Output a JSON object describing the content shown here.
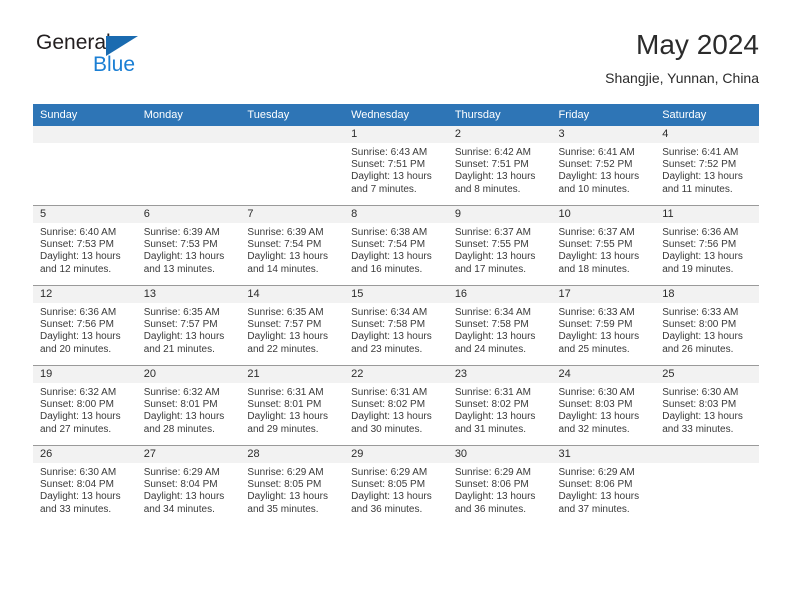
{
  "brand": {
    "name_top": "General",
    "name_bottom": "Blue",
    "triangle_color": "#1a6bb0",
    "blue_color": "#1b7fd4"
  },
  "header": {
    "title": "May 2024",
    "subtitle": "Shangjie, Yunnan, China"
  },
  "theme": {
    "header_bg": "#2e75b6",
    "header_text": "#ffffff",
    "daynum_bg": "#f2f2f2",
    "row_border": "#9a9a9a",
    "body_text": "#3a3a3a"
  },
  "weekdays": [
    "Sunday",
    "Monday",
    "Tuesday",
    "Wednesday",
    "Thursday",
    "Friday",
    "Saturday"
  ],
  "weeks": [
    [
      {
        "day": "",
        "empty": true,
        "sunrise": "",
        "sunset": "",
        "daylight_a": "",
        "daylight_b": ""
      },
      {
        "day": "",
        "empty": true,
        "sunrise": "",
        "sunset": "",
        "daylight_a": "",
        "daylight_b": ""
      },
      {
        "day": "",
        "empty": true,
        "sunrise": "",
        "sunset": "",
        "daylight_a": "",
        "daylight_b": ""
      },
      {
        "day": "1",
        "empty": false,
        "sunrise": "Sunrise: 6:43 AM",
        "sunset": "Sunset: 7:51 PM",
        "daylight_a": "Daylight: 13 hours",
        "daylight_b": "and 7 minutes."
      },
      {
        "day": "2",
        "empty": false,
        "sunrise": "Sunrise: 6:42 AM",
        "sunset": "Sunset: 7:51 PM",
        "daylight_a": "Daylight: 13 hours",
        "daylight_b": "and 8 minutes."
      },
      {
        "day": "3",
        "empty": false,
        "sunrise": "Sunrise: 6:41 AM",
        "sunset": "Sunset: 7:52 PM",
        "daylight_a": "Daylight: 13 hours",
        "daylight_b": "and 10 minutes."
      },
      {
        "day": "4",
        "empty": false,
        "sunrise": "Sunrise: 6:41 AM",
        "sunset": "Sunset: 7:52 PM",
        "daylight_a": "Daylight: 13 hours",
        "daylight_b": "and 11 minutes."
      }
    ],
    [
      {
        "day": "5",
        "empty": false,
        "sunrise": "Sunrise: 6:40 AM",
        "sunset": "Sunset: 7:53 PM",
        "daylight_a": "Daylight: 13 hours",
        "daylight_b": "and 12 minutes."
      },
      {
        "day": "6",
        "empty": false,
        "sunrise": "Sunrise: 6:39 AM",
        "sunset": "Sunset: 7:53 PM",
        "daylight_a": "Daylight: 13 hours",
        "daylight_b": "and 13 minutes."
      },
      {
        "day": "7",
        "empty": false,
        "sunrise": "Sunrise: 6:39 AM",
        "sunset": "Sunset: 7:54 PM",
        "daylight_a": "Daylight: 13 hours",
        "daylight_b": "and 14 minutes."
      },
      {
        "day": "8",
        "empty": false,
        "sunrise": "Sunrise: 6:38 AM",
        "sunset": "Sunset: 7:54 PM",
        "daylight_a": "Daylight: 13 hours",
        "daylight_b": "and 16 minutes."
      },
      {
        "day": "9",
        "empty": false,
        "sunrise": "Sunrise: 6:37 AM",
        "sunset": "Sunset: 7:55 PM",
        "daylight_a": "Daylight: 13 hours",
        "daylight_b": "and 17 minutes."
      },
      {
        "day": "10",
        "empty": false,
        "sunrise": "Sunrise: 6:37 AM",
        "sunset": "Sunset: 7:55 PM",
        "daylight_a": "Daylight: 13 hours",
        "daylight_b": "and 18 minutes."
      },
      {
        "day": "11",
        "empty": false,
        "sunrise": "Sunrise: 6:36 AM",
        "sunset": "Sunset: 7:56 PM",
        "daylight_a": "Daylight: 13 hours",
        "daylight_b": "and 19 minutes."
      }
    ],
    [
      {
        "day": "12",
        "empty": false,
        "sunrise": "Sunrise: 6:36 AM",
        "sunset": "Sunset: 7:56 PM",
        "daylight_a": "Daylight: 13 hours",
        "daylight_b": "and 20 minutes."
      },
      {
        "day": "13",
        "empty": false,
        "sunrise": "Sunrise: 6:35 AM",
        "sunset": "Sunset: 7:57 PM",
        "daylight_a": "Daylight: 13 hours",
        "daylight_b": "and 21 minutes."
      },
      {
        "day": "14",
        "empty": false,
        "sunrise": "Sunrise: 6:35 AM",
        "sunset": "Sunset: 7:57 PM",
        "daylight_a": "Daylight: 13 hours",
        "daylight_b": "and 22 minutes."
      },
      {
        "day": "15",
        "empty": false,
        "sunrise": "Sunrise: 6:34 AM",
        "sunset": "Sunset: 7:58 PM",
        "daylight_a": "Daylight: 13 hours",
        "daylight_b": "and 23 minutes."
      },
      {
        "day": "16",
        "empty": false,
        "sunrise": "Sunrise: 6:34 AM",
        "sunset": "Sunset: 7:58 PM",
        "daylight_a": "Daylight: 13 hours",
        "daylight_b": "and 24 minutes."
      },
      {
        "day": "17",
        "empty": false,
        "sunrise": "Sunrise: 6:33 AM",
        "sunset": "Sunset: 7:59 PM",
        "daylight_a": "Daylight: 13 hours",
        "daylight_b": "and 25 minutes."
      },
      {
        "day": "18",
        "empty": false,
        "sunrise": "Sunrise: 6:33 AM",
        "sunset": "Sunset: 8:00 PM",
        "daylight_a": "Daylight: 13 hours",
        "daylight_b": "and 26 minutes."
      }
    ],
    [
      {
        "day": "19",
        "empty": false,
        "sunrise": "Sunrise: 6:32 AM",
        "sunset": "Sunset: 8:00 PM",
        "daylight_a": "Daylight: 13 hours",
        "daylight_b": "and 27 minutes."
      },
      {
        "day": "20",
        "empty": false,
        "sunrise": "Sunrise: 6:32 AM",
        "sunset": "Sunset: 8:01 PM",
        "daylight_a": "Daylight: 13 hours",
        "daylight_b": "and 28 minutes."
      },
      {
        "day": "21",
        "empty": false,
        "sunrise": "Sunrise: 6:31 AM",
        "sunset": "Sunset: 8:01 PM",
        "daylight_a": "Daylight: 13 hours",
        "daylight_b": "and 29 minutes."
      },
      {
        "day": "22",
        "empty": false,
        "sunrise": "Sunrise: 6:31 AM",
        "sunset": "Sunset: 8:02 PM",
        "daylight_a": "Daylight: 13 hours",
        "daylight_b": "and 30 minutes."
      },
      {
        "day": "23",
        "empty": false,
        "sunrise": "Sunrise: 6:31 AM",
        "sunset": "Sunset: 8:02 PM",
        "daylight_a": "Daylight: 13 hours",
        "daylight_b": "and 31 minutes."
      },
      {
        "day": "24",
        "empty": false,
        "sunrise": "Sunrise: 6:30 AM",
        "sunset": "Sunset: 8:03 PM",
        "daylight_a": "Daylight: 13 hours",
        "daylight_b": "and 32 minutes."
      },
      {
        "day": "25",
        "empty": false,
        "sunrise": "Sunrise: 6:30 AM",
        "sunset": "Sunset: 8:03 PM",
        "daylight_a": "Daylight: 13 hours",
        "daylight_b": "and 33 minutes."
      }
    ],
    [
      {
        "day": "26",
        "empty": false,
        "sunrise": "Sunrise: 6:30 AM",
        "sunset": "Sunset: 8:04 PM",
        "daylight_a": "Daylight: 13 hours",
        "daylight_b": "and 33 minutes."
      },
      {
        "day": "27",
        "empty": false,
        "sunrise": "Sunrise: 6:29 AM",
        "sunset": "Sunset: 8:04 PM",
        "daylight_a": "Daylight: 13 hours",
        "daylight_b": "and 34 minutes."
      },
      {
        "day": "28",
        "empty": false,
        "sunrise": "Sunrise: 6:29 AM",
        "sunset": "Sunset: 8:05 PM",
        "daylight_a": "Daylight: 13 hours",
        "daylight_b": "and 35 minutes."
      },
      {
        "day": "29",
        "empty": false,
        "sunrise": "Sunrise: 6:29 AM",
        "sunset": "Sunset: 8:05 PM",
        "daylight_a": "Daylight: 13 hours",
        "daylight_b": "and 36 minutes."
      },
      {
        "day": "30",
        "empty": false,
        "sunrise": "Sunrise: 6:29 AM",
        "sunset": "Sunset: 8:06 PM",
        "daylight_a": "Daylight: 13 hours",
        "daylight_b": "and 36 minutes."
      },
      {
        "day": "31",
        "empty": false,
        "sunrise": "Sunrise: 6:29 AM",
        "sunset": "Sunset: 8:06 PM",
        "daylight_a": "Daylight: 13 hours",
        "daylight_b": "and 37 minutes."
      },
      {
        "day": "",
        "empty": true,
        "sunrise": "",
        "sunset": "",
        "daylight_a": "",
        "daylight_b": ""
      }
    ]
  ]
}
